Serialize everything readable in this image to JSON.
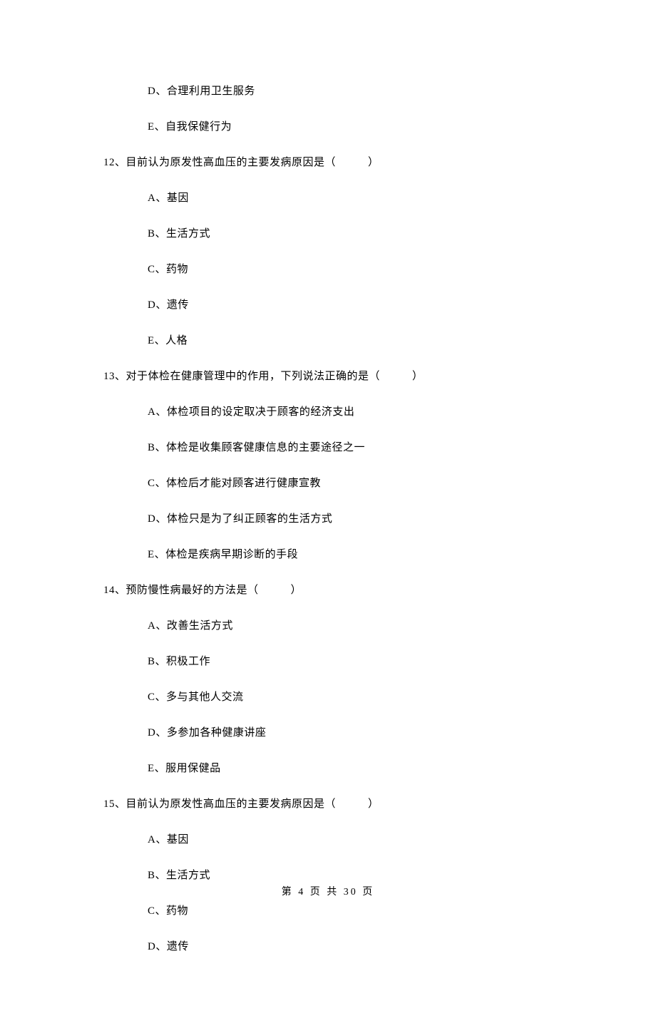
{
  "orphan_options": [
    {
      "label": "D、合理利用卫生服务"
    },
    {
      "label": "E、自我保健行为"
    }
  ],
  "questions": [
    {
      "number": "12、",
      "stem": "目前认为原发性高血压的主要发病原因是（",
      "stem_end": "）",
      "options": [
        {
          "label": "A、基因"
        },
        {
          "label": "B、生活方式"
        },
        {
          "label": "C、药物"
        },
        {
          "label": "D、遗传"
        },
        {
          "label": "E、人格"
        }
      ]
    },
    {
      "number": "13、",
      "stem": "对于体检在健康管理中的作用，下列说法正确的是（",
      "stem_end": "）",
      "options": [
        {
          "label": "A、体检项目的设定取决于顾客的经济支出"
        },
        {
          "label": "B、体检是收集顾客健康信息的主要途径之一"
        },
        {
          "label": "C、体检后才能对顾客进行健康宣教"
        },
        {
          "label": "D、体检只是为了纠正顾客的生活方式"
        },
        {
          "label": "E、体检是疾病早期诊断的手段"
        }
      ]
    },
    {
      "number": "14、",
      "stem": "预防慢性病最好的方法是（",
      "stem_end": "）",
      "options": [
        {
          "label": "A、改善生活方式"
        },
        {
          "label": "B、积极工作"
        },
        {
          "label": "C、多与其他人交流"
        },
        {
          "label": "D、多参加各种健康讲座"
        },
        {
          "label": "E、服用保健品"
        }
      ]
    },
    {
      "number": "15、",
      "stem": "目前认为原发性高血压的主要发病原因是（",
      "stem_end": "）",
      "options": [
        {
          "label": "A、基因"
        },
        {
          "label": "B、生活方式"
        },
        {
          "label": "C、药物"
        },
        {
          "label": "D、遗传"
        }
      ]
    }
  ],
  "footer": {
    "text": "第 4 页 共 30 页"
  }
}
